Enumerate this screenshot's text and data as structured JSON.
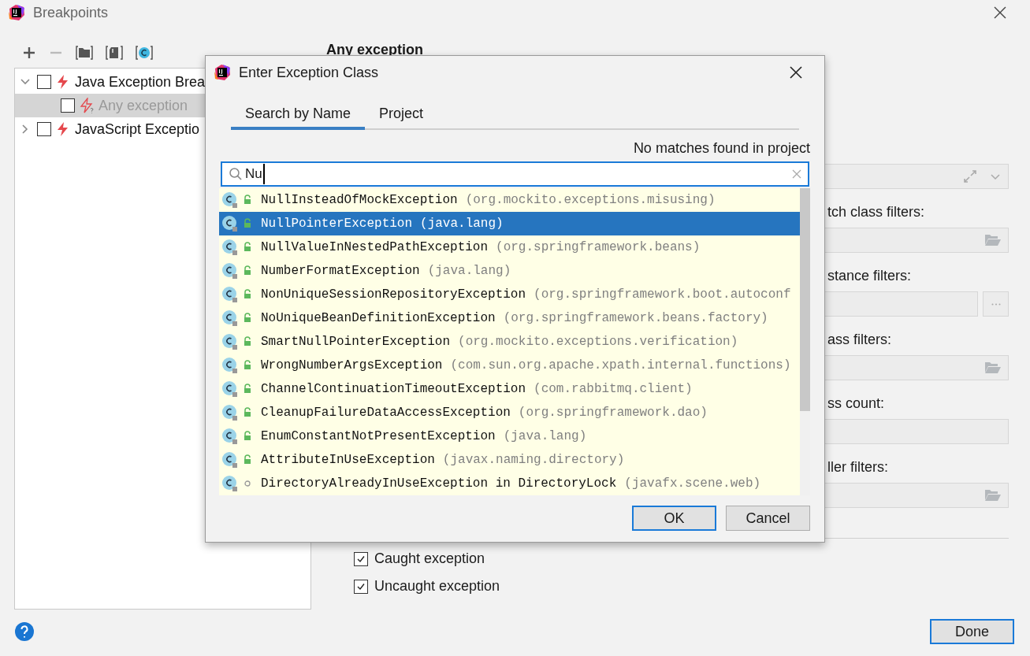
{
  "window": {
    "title": "Breakpoints"
  },
  "tree": [
    {
      "label": "Java Exception Brea",
      "checked": false,
      "expanded": true,
      "selected": false,
      "disabled": false,
      "children": [
        {
          "label": "Any exception",
          "checked": false,
          "selected": true,
          "disabled": true
        }
      ]
    },
    {
      "label": "JavaScript Exceptio",
      "checked": false,
      "expanded": false,
      "selected": false,
      "disabled": false
    }
  ],
  "details": {
    "heading": "Any exception",
    "fields": [
      {
        "kind": "dropdown"
      },
      {
        "kind": "folder",
        "label": "tch class filters:"
      },
      {
        "kind": "more",
        "label": "stance filters:"
      },
      {
        "kind": "folder",
        "label": "ass filters:"
      },
      {
        "kind": "text",
        "label": "ss count:"
      },
      {
        "kind": "folder",
        "label": "ller filters:"
      }
    ],
    "checkboxes": [
      {
        "label": "Caught exception",
        "checked": true
      },
      {
        "label": "Uncaught exception",
        "checked": true
      }
    ]
  },
  "done_button": "Done",
  "dialog": {
    "title": "Enter Exception Class",
    "tabs": [
      {
        "label": "Search by Name",
        "selected": true
      },
      {
        "label": "Project",
        "selected": false
      }
    ],
    "status": "No matches found in project",
    "search": {
      "value": "Nu"
    },
    "results": [
      {
        "name": "NullInsteadOfMockException",
        "package": "(org.mockito.exceptions.misusing)",
        "kind": "public",
        "selected": false
      },
      {
        "name": "NullPointerException",
        "package": "(java.lang)",
        "kind": "public",
        "selected": true
      },
      {
        "name": "NullValueInNestedPathException",
        "package": "(org.springframework.beans)",
        "kind": "public",
        "selected": false
      },
      {
        "name": "NumberFormatException",
        "package": "(java.lang)",
        "kind": "public",
        "selected": false
      },
      {
        "name": "NonUniqueSessionRepositoryException",
        "package": "(org.springframework.boot.autoconf",
        "kind": "public",
        "selected": false
      },
      {
        "name": "NoUniqueBeanDefinitionException",
        "package": "(org.springframework.beans.factory)",
        "kind": "public",
        "selected": false
      },
      {
        "name": "SmartNullPointerException",
        "package": "(org.mockito.exceptions.verification)",
        "kind": "public",
        "selected": false
      },
      {
        "name": "WrongNumberArgsException",
        "package": "(com.sun.org.apache.xpath.internal.functions)",
        "kind": "public",
        "selected": false
      },
      {
        "name": "ChannelContinuationTimeoutException",
        "package": "(com.rabbitmq.client)",
        "kind": "public",
        "selected": false
      },
      {
        "name": "CleanupFailureDataAccessException",
        "package": "(org.springframework.dao)",
        "kind": "public",
        "selected": false
      },
      {
        "name": "EnumConstantNotPresentException",
        "package": "(java.lang)",
        "kind": "public",
        "selected": false
      },
      {
        "name": "AttributeInUseException",
        "package": "(javax.naming.directory)",
        "kind": "public",
        "selected": false
      },
      {
        "name": "DirectoryAlreadyInUseException in DirectoryLock",
        "package": "(javafx.scene.web)",
        "kind": "package",
        "selected": false
      }
    ],
    "buttons": [
      {
        "label": "OK",
        "default": true
      },
      {
        "label": "Cancel",
        "default": false
      }
    ]
  }
}
